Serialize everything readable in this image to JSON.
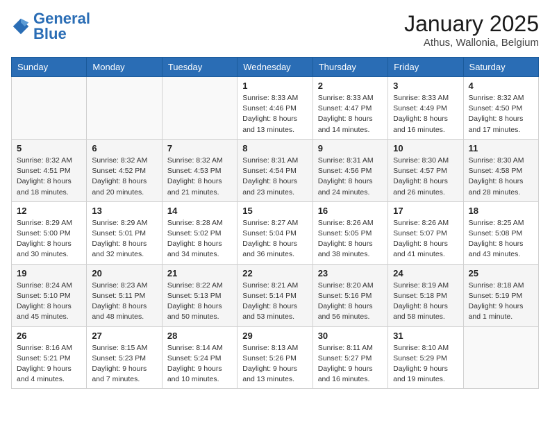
{
  "header": {
    "logo_text_general": "General",
    "logo_text_blue": "Blue",
    "month_title": "January 2025",
    "location": "Athus, Wallonia, Belgium"
  },
  "weekdays": [
    "Sunday",
    "Monday",
    "Tuesday",
    "Wednesday",
    "Thursday",
    "Friday",
    "Saturday"
  ],
  "weeks": [
    {
      "days": [
        {
          "num": "",
          "info": ""
        },
        {
          "num": "",
          "info": ""
        },
        {
          "num": "",
          "info": ""
        },
        {
          "num": "1",
          "info": "Sunrise: 8:33 AM\nSunset: 4:46 PM\nDaylight: 8 hours\nand 13 minutes."
        },
        {
          "num": "2",
          "info": "Sunrise: 8:33 AM\nSunset: 4:47 PM\nDaylight: 8 hours\nand 14 minutes."
        },
        {
          "num": "3",
          "info": "Sunrise: 8:33 AM\nSunset: 4:49 PM\nDaylight: 8 hours\nand 16 minutes."
        },
        {
          "num": "4",
          "info": "Sunrise: 8:32 AM\nSunset: 4:50 PM\nDaylight: 8 hours\nand 17 minutes."
        }
      ]
    },
    {
      "days": [
        {
          "num": "5",
          "info": "Sunrise: 8:32 AM\nSunset: 4:51 PM\nDaylight: 8 hours\nand 18 minutes."
        },
        {
          "num": "6",
          "info": "Sunrise: 8:32 AM\nSunset: 4:52 PM\nDaylight: 8 hours\nand 20 minutes."
        },
        {
          "num": "7",
          "info": "Sunrise: 8:32 AM\nSunset: 4:53 PM\nDaylight: 8 hours\nand 21 minutes."
        },
        {
          "num": "8",
          "info": "Sunrise: 8:31 AM\nSunset: 4:54 PM\nDaylight: 8 hours\nand 23 minutes."
        },
        {
          "num": "9",
          "info": "Sunrise: 8:31 AM\nSunset: 4:56 PM\nDaylight: 8 hours\nand 24 minutes."
        },
        {
          "num": "10",
          "info": "Sunrise: 8:30 AM\nSunset: 4:57 PM\nDaylight: 8 hours\nand 26 minutes."
        },
        {
          "num": "11",
          "info": "Sunrise: 8:30 AM\nSunset: 4:58 PM\nDaylight: 8 hours\nand 28 minutes."
        }
      ]
    },
    {
      "days": [
        {
          "num": "12",
          "info": "Sunrise: 8:29 AM\nSunset: 5:00 PM\nDaylight: 8 hours\nand 30 minutes."
        },
        {
          "num": "13",
          "info": "Sunrise: 8:29 AM\nSunset: 5:01 PM\nDaylight: 8 hours\nand 32 minutes."
        },
        {
          "num": "14",
          "info": "Sunrise: 8:28 AM\nSunset: 5:02 PM\nDaylight: 8 hours\nand 34 minutes."
        },
        {
          "num": "15",
          "info": "Sunrise: 8:27 AM\nSunset: 5:04 PM\nDaylight: 8 hours\nand 36 minutes."
        },
        {
          "num": "16",
          "info": "Sunrise: 8:26 AM\nSunset: 5:05 PM\nDaylight: 8 hours\nand 38 minutes."
        },
        {
          "num": "17",
          "info": "Sunrise: 8:26 AM\nSunset: 5:07 PM\nDaylight: 8 hours\nand 41 minutes."
        },
        {
          "num": "18",
          "info": "Sunrise: 8:25 AM\nSunset: 5:08 PM\nDaylight: 8 hours\nand 43 minutes."
        }
      ]
    },
    {
      "days": [
        {
          "num": "19",
          "info": "Sunrise: 8:24 AM\nSunset: 5:10 PM\nDaylight: 8 hours\nand 45 minutes."
        },
        {
          "num": "20",
          "info": "Sunrise: 8:23 AM\nSunset: 5:11 PM\nDaylight: 8 hours\nand 48 minutes."
        },
        {
          "num": "21",
          "info": "Sunrise: 8:22 AM\nSunset: 5:13 PM\nDaylight: 8 hours\nand 50 minutes."
        },
        {
          "num": "22",
          "info": "Sunrise: 8:21 AM\nSunset: 5:14 PM\nDaylight: 8 hours\nand 53 minutes."
        },
        {
          "num": "23",
          "info": "Sunrise: 8:20 AM\nSunset: 5:16 PM\nDaylight: 8 hours\nand 56 minutes."
        },
        {
          "num": "24",
          "info": "Sunrise: 8:19 AM\nSunset: 5:18 PM\nDaylight: 8 hours\nand 58 minutes."
        },
        {
          "num": "25",
          "info": "Sunrise: 8:18 AM\nSunset: 5:19 PM\nDaylight: 9 hours\nand 1 minute."
        }
      ]
    },
    {
      "days": [
        {
          "num": "26",
          "info": "Sunrise: 8:16 AM\nSunset: 5:21 PM\nDaylight: 9 hours\nand 4 minutes."
        },
        {
          "num": "27",
          "info": "Sunrise: 8:15 AM\nSunset: 5:23 PM\nDaylight: 9 hours\nand 7 minutes."
        },
        {
          "num": "28",
          "info": "Sunrise: 8:14 AM\nSunset: 5:24 PM\nDaylight: 9 hours\nand 10 minutes."
        },
        {
          "num": "29",
          "info": "Sunrise: 8:13 AM\nSunset: 5:26 PM\nDaylight: 9 hours\nand 13 minutes."
        },
        {
          "num": "30",
          "info": "Sunrise: 8:11 AM\nSunset: 5:27 PM\nDaylight: 9 hours\nand 16 minutes."
        },
        {
          "num": "31",
          "info": "Sunrise: 8:10 AM\nSunset: 5:29 PM\nDaylight: 9 hours\nand 19 minutes."
        },
        {
          "num": "",
          "info": ""
        }
      ]
    }
  ]
}
